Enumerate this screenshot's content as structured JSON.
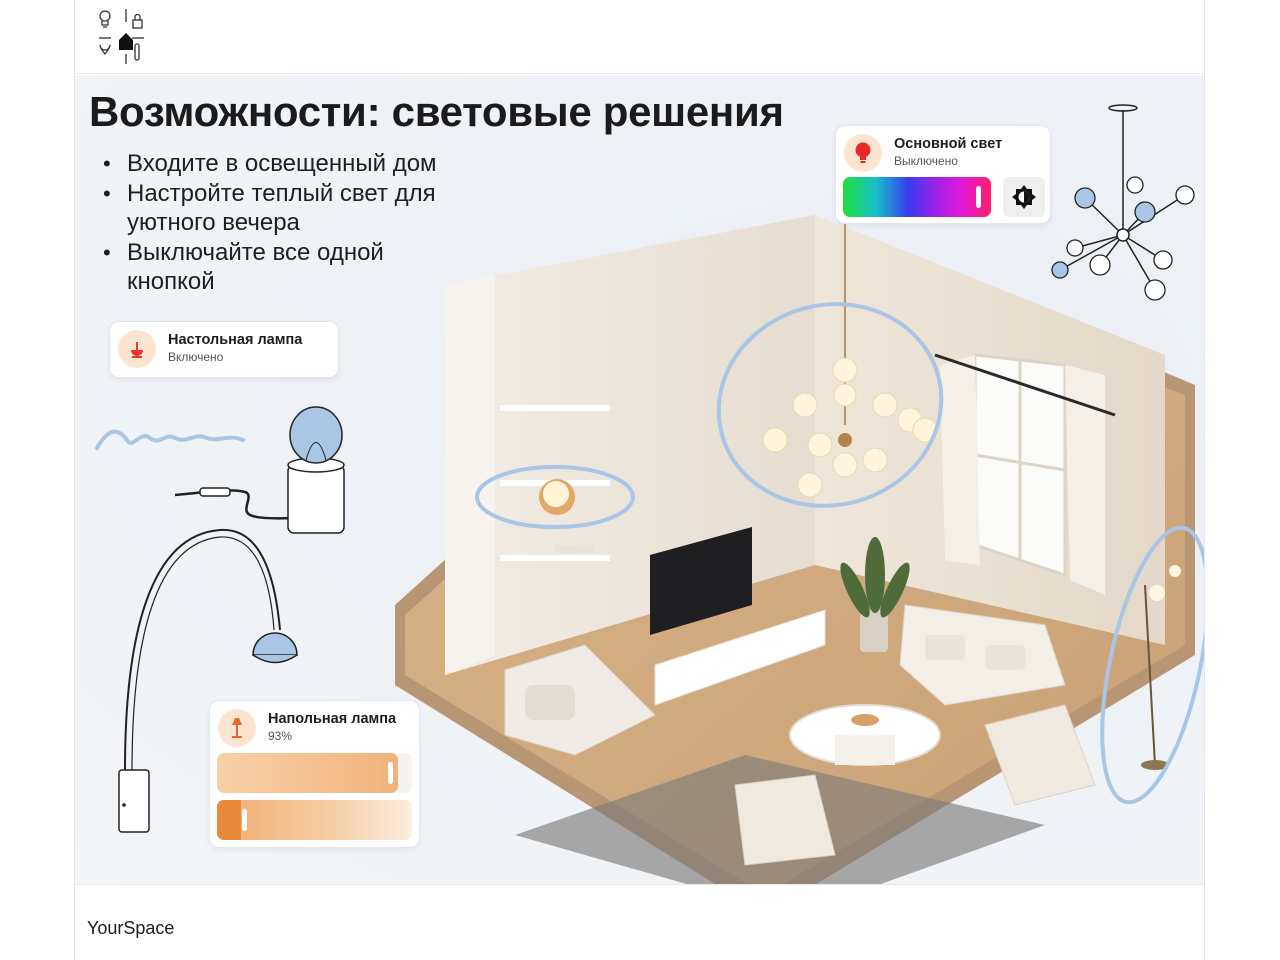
{
  "header": {
    "logo": {
      "icons": [
        "bulb-icon",
        "lock-icon",
        "house-icon",
        "drop-icon",
        "thermometer-icon"
      ]
    }
  },
  "slide": {
    "title": "Возможности: световые решения",
    "bullets": [
      "Входите в освещенный дом",
      "Настройте теплый свет для уютного вечера",
      "Выключайте все одной кнопкой"
    ]
  },
  "devices": {
    "desk_lamp": {
      "name": "Настольная лампа",
      "status": "Включено",
      "icon": "desk-lamp-icon"
    },
    "main_light": {
      "name": "Основной свет",
      "status": "Выключено",
      "icon": "bulb-icon",
      "color_thumb_position": 0.93,
      "brightness_button_icon": "brightness-icon"
    },
    "floor_lamp": {
      "name": "Напольная лампа",
      "status": "93%",
      "icon": "floor-lamp-icon",
      "brightness": 0.93,
      "warmth": 0.13
    }
  },
  "footer": {
    "brand": "YourSpace"
  },
  "colors": {
    "accent_warm": "#f2b27a",
    "highlight_blue": "#a9c6e6",
    "icon_bg": "#fbe5d1",
    "bulb_red": "#e62828"
  }
}
